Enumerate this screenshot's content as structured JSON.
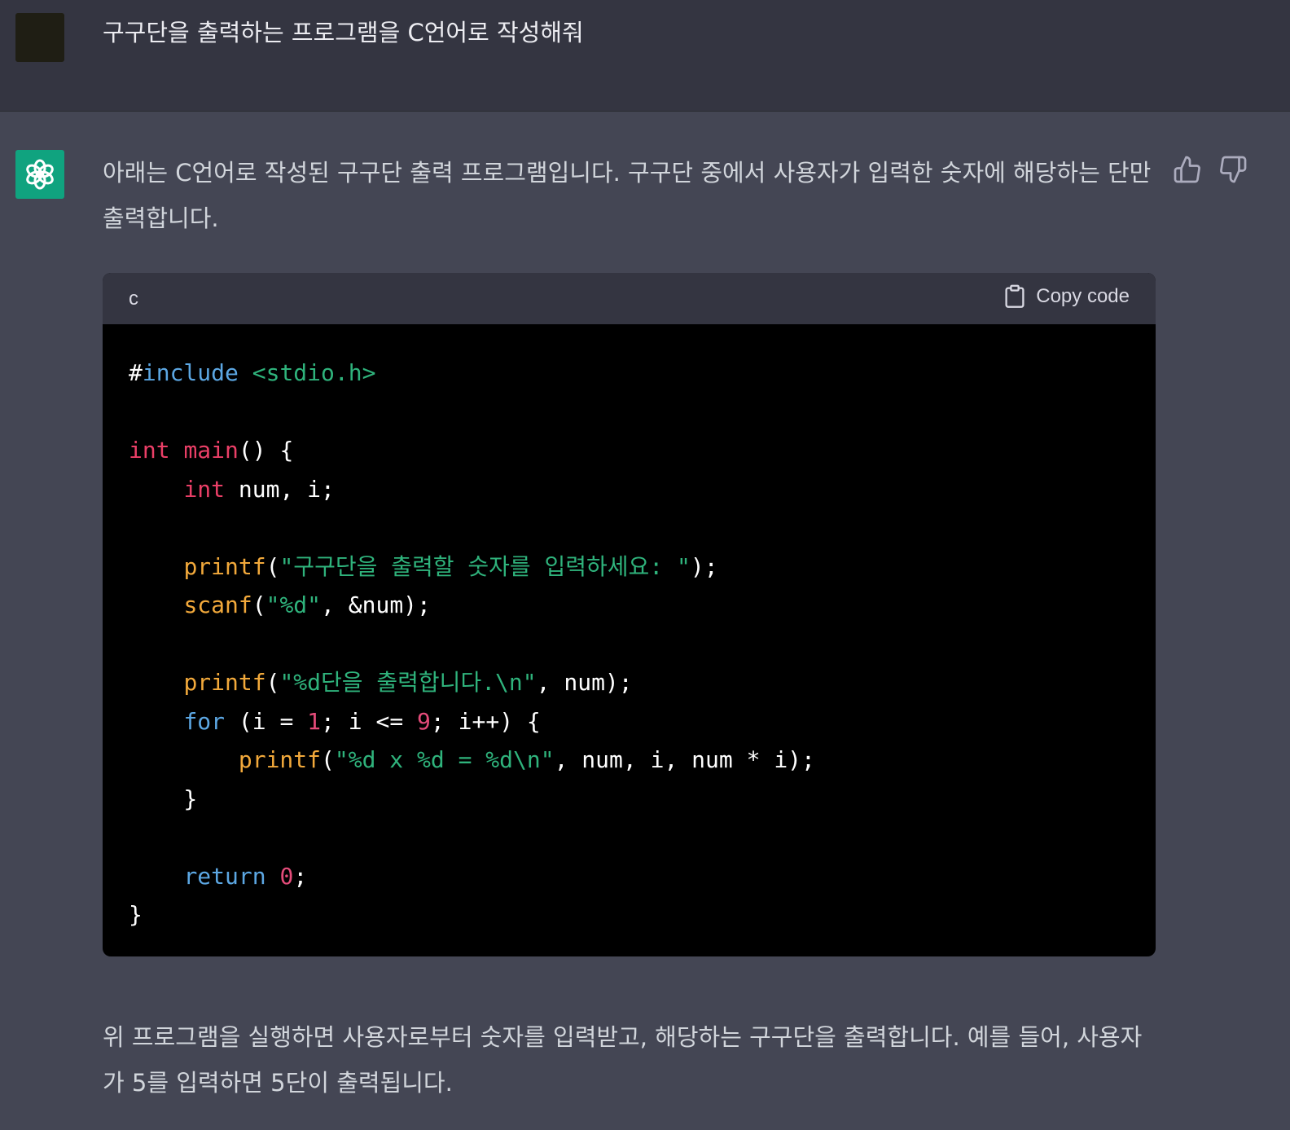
{
  "user_message": {
    "text": "구구단을 출력하는 프로그램을 C언어로 작성해줘"
  },
  "assistant_message": {
    "intro": "아래는 C언어로 작성된 구구단 출력 프로그램입니다. 구구단 중에서 사용자가 입력한 숫자에 해당하는 단만 출력합니다.",
    "outro": "위 프로그램을 실행하면 사용자로부터 숫자를 입력받고, 해당하는 구구단을 출력합니다. 예를 들어, 사용자가 5를 입력하면 5단이 출력됩니다.",
    "code_block": {
      "language": "c",
      "copy_label": "Copy code",
      "lines": [
        [
          {
            "t": "#",
            "c": "plain"
          },
          {
            "t": "include",
            "c": "kw-include"
          },
          {
            "t": " <stdio.h>",
            "c": "str"
          }
        ],
        [],
        [
          {
            "t": "int",
            "c": "type"
          },
          {
            "t": " ",
            "c": "plain"
          },
          {
            "t": "main",
            "c": "fn-main"
          },
          {
            "t": "() {",
            "c": "plain"
          }
        ],
        [
          {
            "t": "    ",
            "c": "plain"
          },
          {
            "t": "int",
            "c": "type"
          },
          {
            "t": " num, i;",
            "c": "plain"
          }
        ],
        [],
        [
          {
            "t": "    ",
            "c": "plain"
          },
          {
            "t": "printf",
            "c": "fn"
          },
          {
            "t": "(",
            "c": "plain"
          },
          {
            "t": "\"구구단을 출력할 숫자를 입력하세요: \"",
            "c": "str"
          },
          {
            "t": ");",
            "c": "plain"
          }
        ],
        [
          {
            "t": "    ",
            "c": "plain"
          },
          {
            "t": "scanf",
            "c": "fn"
          },
          {
            "t": "(",
            "c": "plain"
          },
          {
            "t": "\"%d\"",
            "c": "str"
          },
          {
            "t": ", &num);",
            "c": "plain"
          }
        ],
        [],
        [
          {
            "t": "    ",
            "c": "plain"
          },
          {
            "t": "printf",
            "c": "fn"
          },
          {
            "t": "(",
            "c": "plain"
          },
          {
            "t": "\"%d단을 출력합니다.\\n\"",
            "c": "str"
          },
          {
            "t": ", num);",
            "c": "plain"
          }
        ],
        [
          {
            "t": "    ",
            "c": "plain"
          },
          {
            "t": "for",
            "c": "kw"
          },
          {
            "t": " (i = ",
            "c": "plain"
          },
          {
            "t": "1",
            "c": "num"
          },
          {
            "t": "; i <= ",
            "c": "plain"
          },
          {
            "t": "9",
            "c": "num"
          },
          {
            "t": "; i++) {",
            "c": "plain"
          }
        ],
        [
          {
            "t": "        ",
            "c": "plain"
          },
          {
            "t": "printf",
            "c": "fn"
          },
          {
            "t": "(",
            "c": "plain"
          },
          {
            "t": "\"%d x %d = %d\\n\"",
            "c": "str"
          },
          {
            "t": ", num, i, num * i);",
            "c": "plain"
          }
        ],
        [
          {
            "t": "    }",
            "c": "plain"
          }
        ],
        [],
        [
          {
            "t": "    ",
            "c": "plain"
          },
          {
            "t": "return",
            "c": "kw"
          },
          {
            "t": " ",
            "c": "plain"
          },
          {
            "t": "0",
            "c": "num"
          },
          {
            "t": ";",
            "c": "plain"
          }
        ],
        [
          {
            "t": "}",
            "c": "plain"
          }
        ]
      ]
    }
  },
  "icons": {
    "assistant_avatar": "openai-logo-icon",
    "copy": "clipboard-icon",
    "thumbs_up": "thumbs-up-icon",
    "thumbs_down": "thumbs-down-icon"
  },
  "colors": {
    "background": "#444654",
    "user_background": "#343541",
    "accent": "#10a37f",
    "code_background": "#000000"
  }
}
